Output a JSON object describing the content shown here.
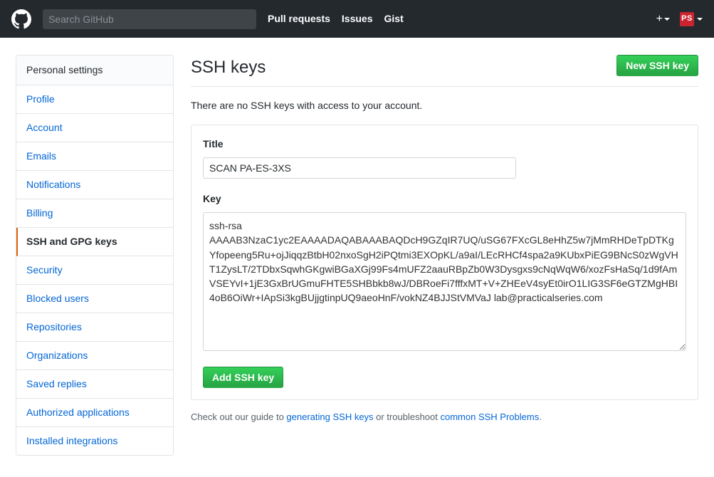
{
  "header": {
    "search_placeholder": "Search GitHub",
    "nav": {
      "pull_requests": "Pull requests",
      "issues": "Issues",
      "gist": "Gist"
    },
    "avatar_initials": "PS"
  },
  "sidebar": {
    "heading": "Personal settings",
    "items": [
      {
        "label": "Profile",
        "selected": false
      },
      {
        "label": "Account",
        "selected": false
      },
      {
        "label": "Emails",
        "selected": false
      },
      {
        "label": "Notifications",
        "selected": false
      },
      {
        "label": "Billing",
        "selected": false
      },
      {
        "label": "SSH and GPG keys",
        "selected": true
      },
      {
        "label": "Security",
        "selected": false
      },
      {
        "label": "Blocked users",
        "selected": false
      },
      {
        "label": "Repositories",
        "selected": false
      },
      {
        "label": "Organizations",
        "selected": false
      },
      {
        "label": "Saved replies",
        "selected": false
      },
      {
        "label": "Authorized applications",
        "selected": false
      },
      {
        "label": "Installed integrations",
        "selected": false
      }
    ]
  },
  "page": {
    "title": "SSH keys",
    "new_button": "New SSH key",
    "empty_msg": "There are no SSH keys with access to your account.",
    "form": {
      "title_label": "Title",
      "title_value": "SCAN PA-ES-3XS",
      "key_label": "Key",
      "key_value": "ssh-rsa AAAAB3NzaC1yc2EAAAADAQABAAABAQDcH9GZqIR7UQ/uSG67FXcGL8eHhZ5w7jMmRHDeTpDTKgYfopeeng5Ru+ojJiqqzBtbH02nxoSgH2iPQtmi3EXOpKL/a9aI/LEcRHCf4spa2a9KUbxPiEG9BNcS0zWgVHT1ZysLT/2TDbxSqwhGKgwiBGaXGj99Fs4mUFZ2aauRBpZb0W3Dysgxs9cNqWqW6/xozFsHaSq/1d9fAmVSEYvI+1jE3GxBrUGmuFHTE5SHBbkb8wJ/DBRoeFi7fffxMT+V+ZHEeV4syEt0irO1LIG3SF6eGTZMgHBI4oB6OiWr+IApSi3kgBUjjgtinpUQ9aeoHnF/vokNZ4BJJStVMVaJ lab@practicalseries.com",
      "submit": "Add SSH key"
    },
    "footer": {
      "prefix": "Check out our guide to ",
      "link1": "generating SSH keys",
      "middle": " or troubleshoot ",
      "link2": "common SSH Problems",
      "suffix": "."
    }
  }
}
